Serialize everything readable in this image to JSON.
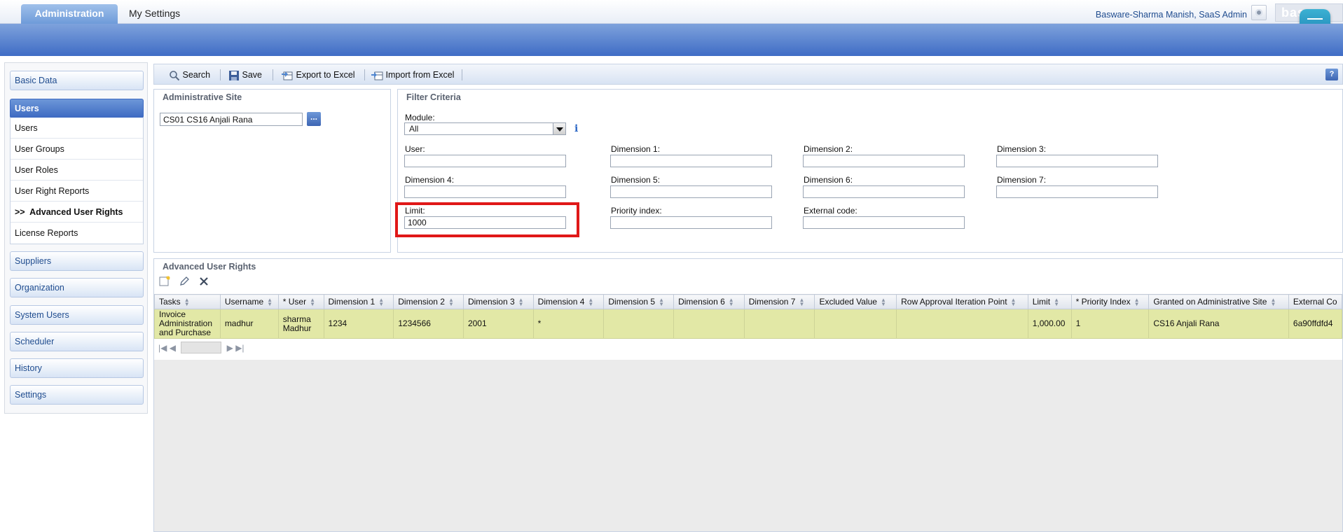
{
  "header": {
    "tabs": [
      {
        "label": "Administration",
        "active": true
      },
      {
        "label": "My Settings",
        "active": false
      }
    ],
    "user": "Basware-Sharma Manish, SaaS Admin",
    "logo_text": "bas",
    "icons": [
      "settings-circle-icon",
      "hamburger-menu-icon"
    ]
  },
  "sidebar": {
    "sections": [
      {
        "label": "Basic Data"
      },
      {
        "label": "Users",
        "active": true
      },
      {
        "label": "Suppliers"
      },
      {
        "label": "Organization"
      },
      {
        "label": "System Users"
      },
      {
        "label": "Scheduler"
      },
      {
        "label": "History"
      },
      {
        "label": "Settings"
      }
    ],
    "users_items": [
      {
        "label": "Users"
      },
      {
        "label": "User Groups"
      },
      {
        "label": "User Roles"
      },
      {
        "label": "User Right Reports"
      },
      {
        "label": "Advanced User Rights",
        "selected": true,
        "marker": ">>"
      },
      {
        "label": "License Reports"
      }
    ]
  },
  "toolbar": {
    "search": "Search",
    "save": "Save",
    "export": "Export to Excel",
    "import": "Import from Excel",
    "help": "?"
  },
  "admin_site": {
    "title": "Administrative Site",
    "value": "CS01 CS16 Anjali Rana",
    "browse": "..."
  },
  "filter": {
    "title": "Filter Criteria",
    "module_label": "Module:",
    "module_value": "All",
    "info": "i",
    "fields": {
      "user": {
        "label": "User:",
        "value": ""
      },
      "dim1": {
        "label": "Dimension 1:",
        "value": ""
      },
      "dim2": {
        "label": "Dimension 2:",
        "value": ""
      },
      "dim3": {
        "label": "Dimension 3:",
        "value": ""
      },
      "dim4": {
        "label": "Dimension 4:",
        "value": ""
      },
      "dim5": {
        "label": "Dimension 5:",
        "value": ""
      },
      "dim6": {
        "label": "Dimension 6:",
        "value": ""
      },
      "dim7": {
        "label": "Dimension 7:",
        "value": ""
      },
      "limit": {
        "label": "Limit:",
        "value": "1000"
      },
      "priority": {
        "label": "Priority index:",
        "value": ""
      },
      "external": {
        "label": "External code:",
        "value": ""
      }
    }
  },
  "grid": {
    "title": "Advanced User Rights",
    "columns": [
      "Tasks",
      "Username",
      "* User",
      "Dimension 1",
      "Dimension 2",
      "Dimension 3",
      "Dimension 4",
      "Dimension 5",
      "Dimension 6",
      "Dimension 7",
      "Excluded Value",
      "Row Approval Iteration Point",
      "Limit",
      "* Priority Index",
      "Granted on Administrative Site",
      "External Co"
    ],
    "rows": [
      {
        "tasks": "Invoice Administration and Purchase",
        "username": "madhur",
        "user": "sharma Madhur",
        "dim1": "1234",
        "dim2": "1234566",
        "dim3": "2001",
        "dim4": "*",
        "dim5": "",
        "dim6": "",
        "dim7": "",
        "excluded": "",
        "row_approval": "",
        "limit": "1,000.00",
        "priority": "1",
        "granted": "CS16 Anjali Rana",
        "external": "6a90ffdfd4"
      }
    ]
  },
  "colors": {
    "accent_blue": "#3f6cc5",
    "row_highlight": "#e2e8a6",
    "highlight_box": "#e01818"
  }
}
